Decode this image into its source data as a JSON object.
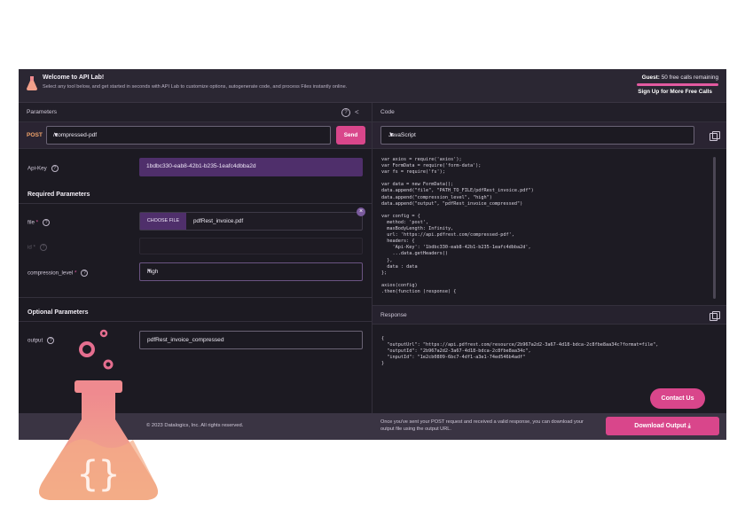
{
  "banner": {
    "title": "Welcome to API Lab!",
    "subtitle": "Select any tool below, and get started in seconds with API Lab to customize options, autogenerate code, and process Files instantly online.",
    "guest_label": "Guest:",
    "guest_calls": "50 free calls remaining",
    "signup": "Sign Up for More Free Calls"
  },
  "parameters": {
    "header": "Parameters",
    "method": "POST",
    "endpoint": "/compressed-pdf",
    "send": "Send",
    "api_key_label": "Api-Key",
    "api_key_value": "1bdbc330-eab8-42b1-b235-1eafc4dbba2d",
    "required_title": "Required Parameters",
    "file_label": "file",
    "choose_file": "CHOOSE FILE",
    "file_name": "pdfRest_invoice.pdf",
    "id_label": "id",
    "compression_label": "compression_level",
    "compression_value": "high",
    "optional_title": "Optional Parameters",
    "output_label": "output",
    "output_value": "pdfRest_invoice_compressed"
  },
  "code_panel": {
    "header": "Code",
    "language": "JavaScript",
    "lines": [
      "var axios = require('axios');",
      "var FormData = require('form-data');",
      "var fs = require('fs');",
      "",
      "var data = new FormData();",
      "data.append(\"file\", \"PATH_TO_FILE/pdfRest_invoice.pdf\")",
      "data.append(\"compression_level\", \"high\")",
      "data.append(\"output\", \"pdfRest_invoice_compressed\")",
      "",
      "var config = {",
      "  method: 'post',",
      "  maxBodyLength: Infinity,",
      "  url: 'https://api.pdfrest.com/compressed-pdf',",
      "  headers: {",
      "    'Api-Key': '1bdbc330-eab8-42b1-b235-1eafc4dbba2d',",
      "    ...data.getHeaders()",
      "  },",
      "  data : data",
      "};",
      "",
      "axios(config)",
      ".then(function (response) {"
    ]
  },
  "response_panel": {
    "header": "Response",
    "lines": [
      "{",
      "  \"outputUrl\": \"https://api.pdfrest.com/resource/2b967a2d2-3a67-4d18-bdca-2c8fbe8aa34c?format=file\",",
      "  \"outputId\": \"2b967a2d2-3a67-4d18-bdca-2c8fbe8aa34c\",",
      "  \"inputId\": \"1e2cb0809-6bc7-4df1-a3e1-74ed546b4adf\"",
      "}"
    ]
  },
  "footer": {
    "copyright": "© 2023 Datalogics, Inc. All rights reserved.",
    "note": "Once you've sent your POST request and received a valid response, you can download your output file using the output URL.",
    "download": "Download Output",
    "contact": "Contact Us"
  },
  "colors": {
    "accent": "#d9468b",
    "background": "#1c1a22",
    "flask_top": "#ef8a8f",
    "flask_bottom": "#f2b08a"
  }
}
